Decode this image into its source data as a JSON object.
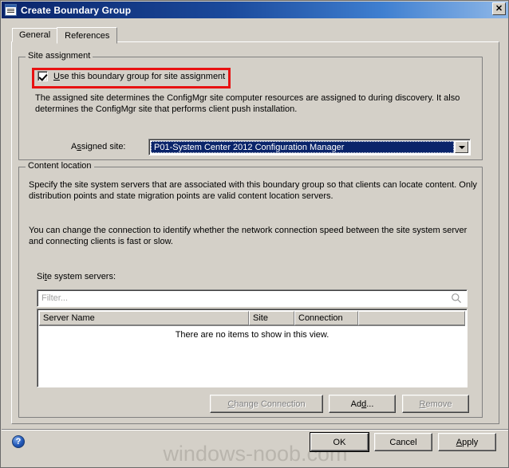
{
  "window": {
    "title": "Create Boundary Group",
    "icon": "window-document-icon",
    "close_label": "✕"
  },
  "tabs": [
    {
      "label": "General",
      "active": false
    },
    {
      "label": "References",
      "active": true
    }
  ],
  "site_assignment": {
    "caption": "Site assignment",
    "checkbox": {
      "label_prefix": "",
      "accel": "U",
      "label_rest": "se this boundary group for site assignment",
      "checked": true
    },
    "description": "The assigned site determines the ConfigMgr site computer resources are assigned to during discovery. It also determines the ConfigMgr site that performs client push installation.",
    "assigned_site": {
      "label_prefix": "A",
      "accel": "s",
      "label_rest": "signed site:",
      "value": "P01-System Center 2012 Configuration Manager"
    }
  },
  "content_location": {
    "caption": "Content location",
    "description_1": "Specify the site system servers that are associated with this boundary group so that clients can locate content. Only distribution points and state migration points are valid content location servers.",
    "description_2": "You can change the connection to identify whether the network connection speed between the site system server and connecting clients is fast or slow.",
    "servers_label_prefix": "Si",
    "servers_label_accel": "t",
    "servers_label_rest": "e system servers:",
    "filter": {
      "value": "",
      "placeholder": "Filter...",
      "icon": "search-icon"
    },
    "table": {
      "columns": [
        "Server Name",
        "Site",
        "Connection",
        ""
      ],
      "rows": [],
      "empty_message": "There are no items to show in this view."
    },
    "buttons": [
      {
        "label_prefix": "",
        "accel": "C",
        "label_rest": "hange Connection",
        "enabled": false
      },
      {
        "label_prefix": "Ad",
        "accel": "d",
        "label_rest": "...",
        "enabled": true
      },
      {
        "label_prefix": "",
        "accel": "R",
        "label_rest": "emove",
        "enabled": false
      }
    ]
  },
  "footer": {
    "help_icon": "help-icon",
    "help_glyph": "?",
    "buttons": [
      {
        "label_prefix": "OK",
        "accel": "",
        "label_rest": "",
        "default": true
      },
      {
        "label_prefix": "Cancel",
        "accel": "",
        "label_rest": "",
        "default": false
      },
      {
        "label_prefix": "",
        "accel": "A",
        "label_rest": "pply",
        "default": false
      }
    ]
  },
  "watermark": "windows-noob.com",
  "colors": {
    "dialog_face": "#d4d0c8",
    "title_start": "#0a246a",
    "title_end": "#8fb8e8",
    "highlight_red": "#e81212",
    "selection_blue": "#0a246a"
  }
}
